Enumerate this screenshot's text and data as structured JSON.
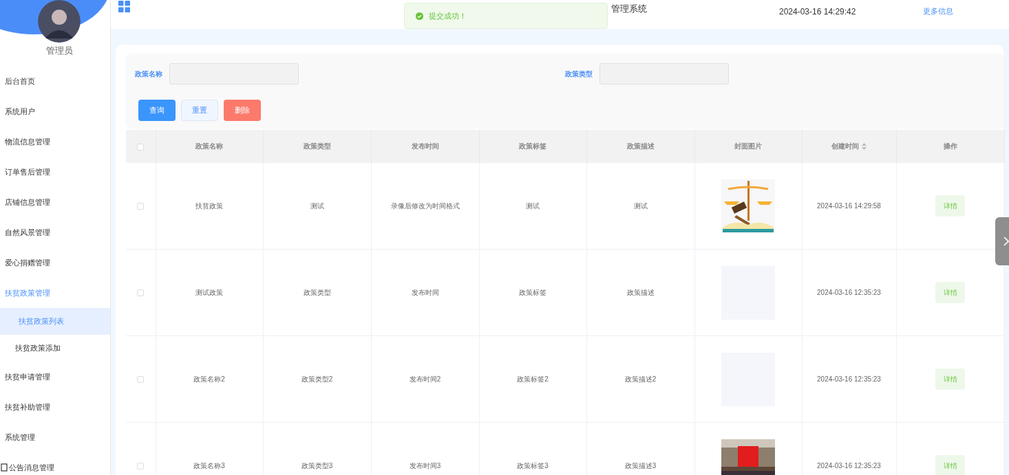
{
  "sidebar": {
    "user": "管理员",
    "items": [
      {
        "label": "后台首页",
        "selected": false
      },
      {
        "label": "系统用户",
        "selected": false
      },
      {
        "label": "物流信息管理",
        "selected": false
      },
      {
        "label": "订单售后管理",
        "selected": false
      },
      {
        "label": "店铺信息管理",
        "selected": false
      },
      {
        "label": "自然风景管理",
        "selected": false
      },
      {
        "label": "爱心捐赠管理",
        "selected": false
      },
      {
        "label": "扶贫政策管理",
        "selected": false,
        "expanded": true,
        "children": [
          {
            "label": "扶贫政策列表",
            "selected": true
          },
          {
            "label": "扶贫政策添加",
            "selected": false
          }
        ]
      },
      {
        "label": "扶贫申请管理",
        "selected": false
      },
      {
        "label": "扶贫补助管理",
        "selected": false
      },
      {
        "label": "系统管理",
        "selected": false
      },
      {
        "label": "公告消息管理",
        "selected": false
      }
    ]
  },
  "header": {
    "title": "管理系统",
    "datetime": "2024-03-16 14:29:42",
    "more_link": "更多信息"
  },
  "toast": {
    "message": "提交成功！"
  },
  "search": {
    "fields": [
      {
        "label": "政策名称"
      },
      {
        "label": "政策类型"
      }
    ],
    "buttons": [
      {
        "label": "查询",
        "kind": "primary"
      },
      {
        "label": "重置",
        "kind": "plain"
      },
      {
        "label": "删除",
        "kind": "danger"
      }
    ]
  },
  "table": {
    "all_checked": false,
    "columns": [
      "政策名称",
      "政策类型",
      "发布时间",
      "政策标签",
      "政策描述",
      "封面图片",
      "创建时间",
      "操作"
    ],
    "rows": [
      {
        "checked": false,
        "cells": [
          "扶贫政策",
          "测试",
          "录像后修改为时间格式",
          "测试",
          "测试"
        ],
        "created": "2024-03-16 14:29:58",
        "action": "详情"
      },
      {
        "checked": false,
        "cells": [
          "测试政策",
          "政策类型",
          "发布时间",
          "政策标签",
          "政策描述"
        ],
        "cover": {
          "kind": "empty"
        },
        "created": "2024-03-16 12:35:23",
        "action": "详情"
      },
      {
        "checked": false,
        "cells": [
          "政策名称2",
          "政策类型2",
          "发布时间2",
          "政策标签2",
          "政策描述2"
        ],
        "cover": {
          "kind": "empty"
        },
        "created": "2024-03-16 12:35:23",
        "action": "详情"
      },
      {
        "checked": false,
        "cells": [
          "政策名称3",
          "政策类型3",
          "发布时间3",
          "政策标签3",
          "政策描述3"
        ],
        "created": "2024-03-16 12:35:23",
        "action": "详情"
      }
    ]
  }
}
